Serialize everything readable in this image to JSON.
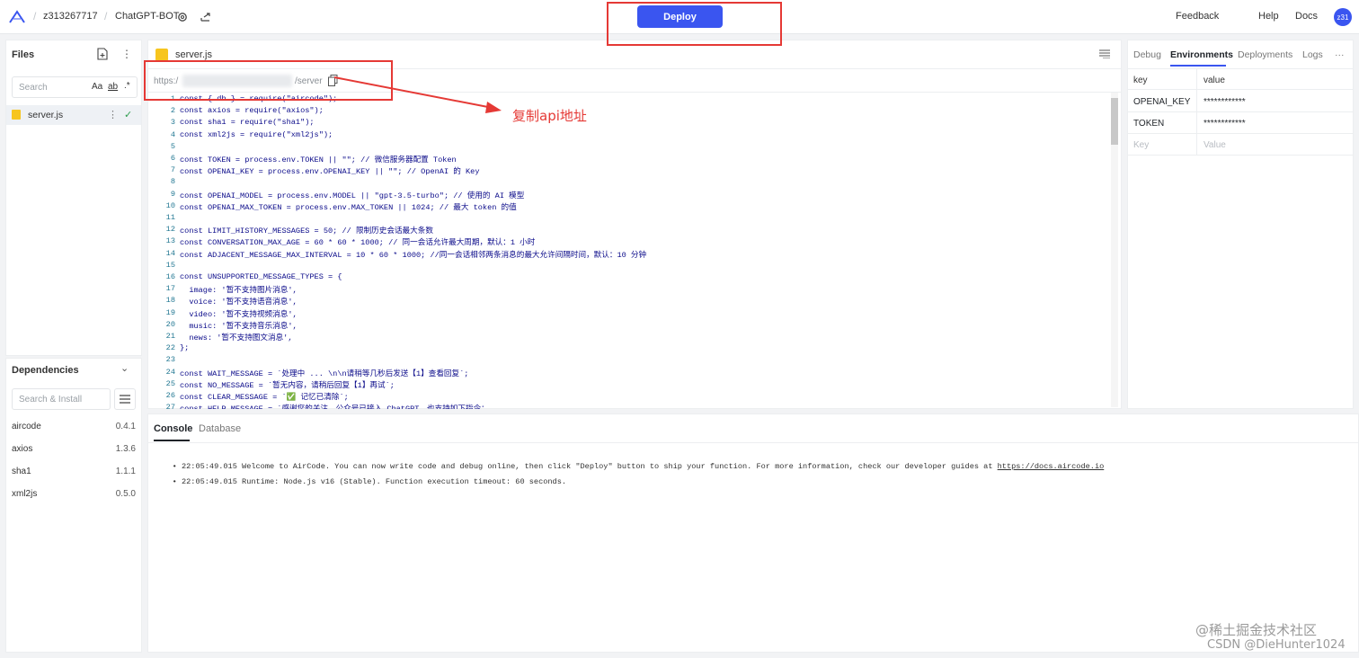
{
  "header": {
    "user": "z313267717",
    "project": "ChatGPT-BOT",
    "deploy_label": "Deploy",
    "links": [
      "Feedback",
      "Help",
      "Docs"
    ],
    "avatar_text": "z31"
  },
  "files_panel": {
    "title": "Files",
    "search_placeholder": "Search",
    "search_options": [
      "Aa",
      "ab",
      ".*"
    ],
    "files": [
      {
        "name": "server.js"
      }
    ]
  },
  "deps_panel": {
    "title": "Dependencies",
    "search_placeholder": "Search & Install",
    "items": [
      {
        "name": "aircode",
        "version": "0.4.1"
      },
      {
        "name": "axios",
        "version": "1.3.6"
      },
      {
        "name": "sha1",
        "version": "1.1.1"
      },
      {
        "name": "xml2js",
        "version": "0.5.0"
      }
    ]
  },
  "editor": {
    "tab": "server.js",
    "url_prefix": "https:/",
    "url_suffix": "/server",
    "code_lines": [
      {
        "n": "1",
        "t": "const { db } = require(\"aircode\");"
      },
      {
        "n": "2",
        "t": "const axios = require(\"axios\");"
      },
      {
        "n": "3",
        "t": "const sha1 = require(\"sha1\");"
      },
      {
        "n": "4",
        "t": "const xml2js = require(\"xml2js\");"
      },
      {
        "n": "5",
        "t": ""
      },
      {
        "n": "6",
        "t": "const TOKEN = process.env.TOKEN || \"\"; // 微信服务器配置 Token"
      },
      {
        "n": "7",
        "t": "const OPENAI_KEY = process.env.OPENAI_KEY || \"\"; // OpenAI 的 Key"
      },
      {
        "n": "8",
        "t": ""
      },
      {
        "n": "9",
        "t": "const OPENAI_MODEL = process.env.MODEL || \"gpt-3.5-turbo\"; // 使用的 AI 模型"
      },
      {
        "n": "10",
        "t": "const OPENAI_MAX_TOKEN = process.env.MAX_TOKEN || 1024; // 最大 token 的值"
      },
      {
        "n": "11",
        "t": ""
      },
      {
        "n": "12",
        "t": "const LIMIT_HISTORY_MESSAGES = 50; // 限制历史会话最大条数"
      },
      {
        "n": "13",
        "t": "const CONVERSATION_MAX_AGE = 60 * 60 * 1000; // 同一会话允许最大周期，默认：1 小时"
      },
      {
        "n": "14",
        "t": "const ADJACENT_MESSAGE_MAX_INTERVAL = 10 * 60 * 1000; //同一会话相邻两条消息的最大允许间隔时间，默认：10 分钟"
      },
      {
        "n": "15",
        "t": ""
      },
      {
        "n": "16",
        "t": "const UNSUPPORTED_MESSAGE_TYPES = {"
      },
      {
        "n": "17",
        "t": "  image: '暂不支持图片消息',"
      },
      {
        "n": "18",
        "t": "  voice: '暂不支持语音消息',"
      },
      {
        "n": "19",
        "t": "  video: '暂不支持视频消息',"
      },
      {
        "n": "20",
        "t": "  music: '暂不支持音乐消息',"
      },
      {
        "n": "21",
        "t": "  news: '暂不支持图文消息',"
      },
      {
        "n": "22",
        "t": "};"
      },
      {
        "n": "23",
        "t": ""
      },
      {
        "n": "24",
        "t": "const WAIT_MESSAGE = `处理中 ... \\n\\n请稍等几秒后发送【1】查看回复`;"
      },
      {
        "n": "25",
        "t": "const NO_MESSAGE = `暂无内容，请稍后回复【1】再试`;"
      },
      {
        "n": "26",
        "t": "const CLEAR_MESSAGE = `✅ 记忆已清除`;"
      },
      {
        "n": "27",
        "t": "const HELP_MESSAGE = `感谢您的关注，公众号已接入 ChatGPT，也支持如下指令："
      }
    ]
  },
  "env_panel": {
    "tabs": [
      "Debug",
      "Environments",
      "Deployments",
      "Logs"
    ],
    "more": "···",
    "col_key": "key",
    "col_value": "value",
    "rows": [
      {
        "key": "OPENAI_KEY",
        "value": "************"
      },
      {
        "key": "TOKEN",
        "value": "************"
      }
    ],
    "key_placeholder": "Key",
    "value_placeholder": "Value"
  },
  "console": {
    "tabs": [
      "Console",
      "Database"
    ],
    "lines": [
      {
        "time": "22:05:49.015",
        "text": "Welcome to AirCode. You can now write code and debug online, then click \"Deploy\" button to ship your function. For more information, check our developer guides at ",
        "link": "https://docs.aircode.io"
      },
      {
        "time": "22:05:49.015",
        "text": "Runtime: Node.js v16 (Stable). Function execution timeout: 60 seconds.",
        "link": ""
      }
    ]
  },
  "annotation": {
    "text": "复制api地址"
  },
  "watermark": {
    "line1": "@稀土掘金技术社区",
    "line2": "CSDN @DieHunter1024"
  },
  "colors": {
    "accent": "#3a55f0",
    "annotation": "#e53935"
  }
}
